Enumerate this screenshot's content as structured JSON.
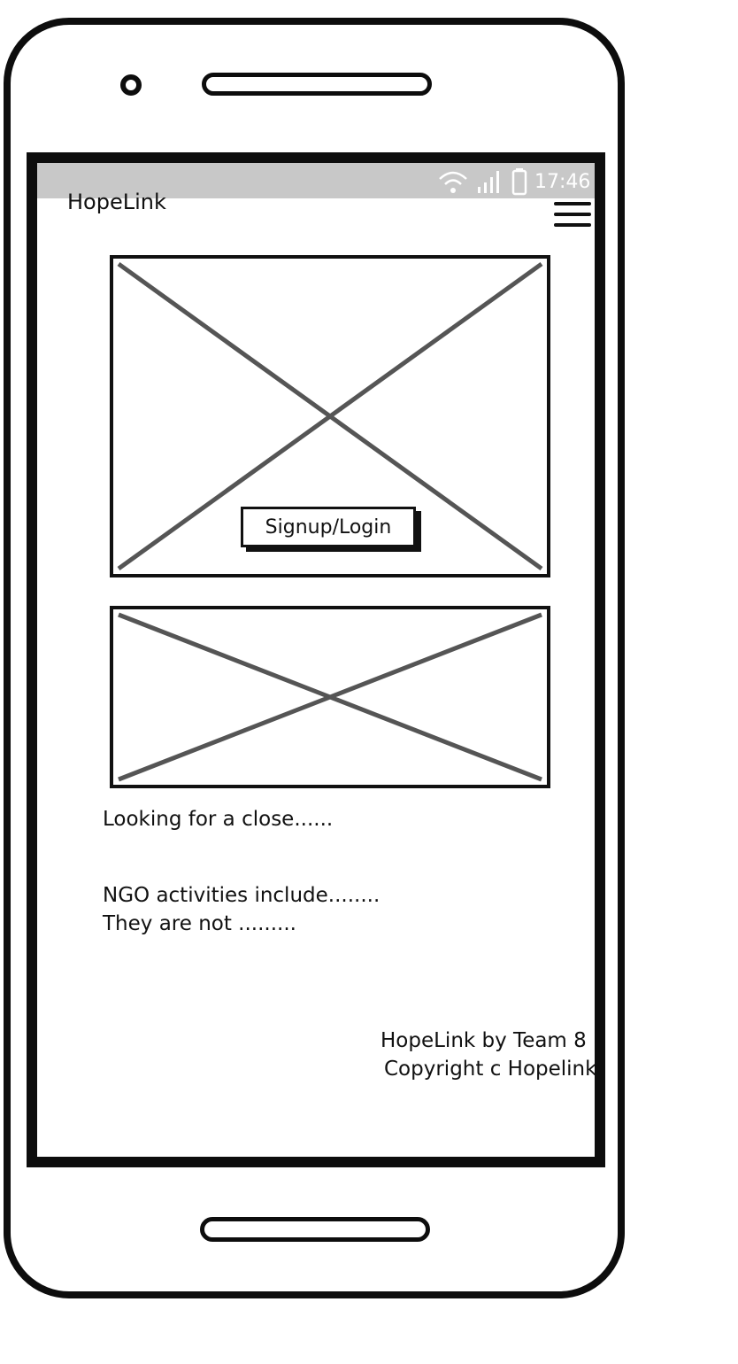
{
  "status_bar": {
    "time": "17:46",
    "icons": [
      "wifi-icon",
      "signal-icon",
      "battery-icon"
    ]
  },
  "header": {
    "app_title": "HopeLink",
    "menu_icon": "hamburger-menu-icon"
  },
  "hero": {
    "image": "image-placeholder",
    "login_button": "Signup/Login"
  },
  "secondary_image": "image-placeholder",
  "content": {
    "line1": "Looking for a close......",
    "line2": "NGO activities include........",
    "line3": "They are not ........."
  },
  "footer": {
    "line1": "HopeLink by Team 8",
    "line2": "Copyright c Hopelink"
  }
}
